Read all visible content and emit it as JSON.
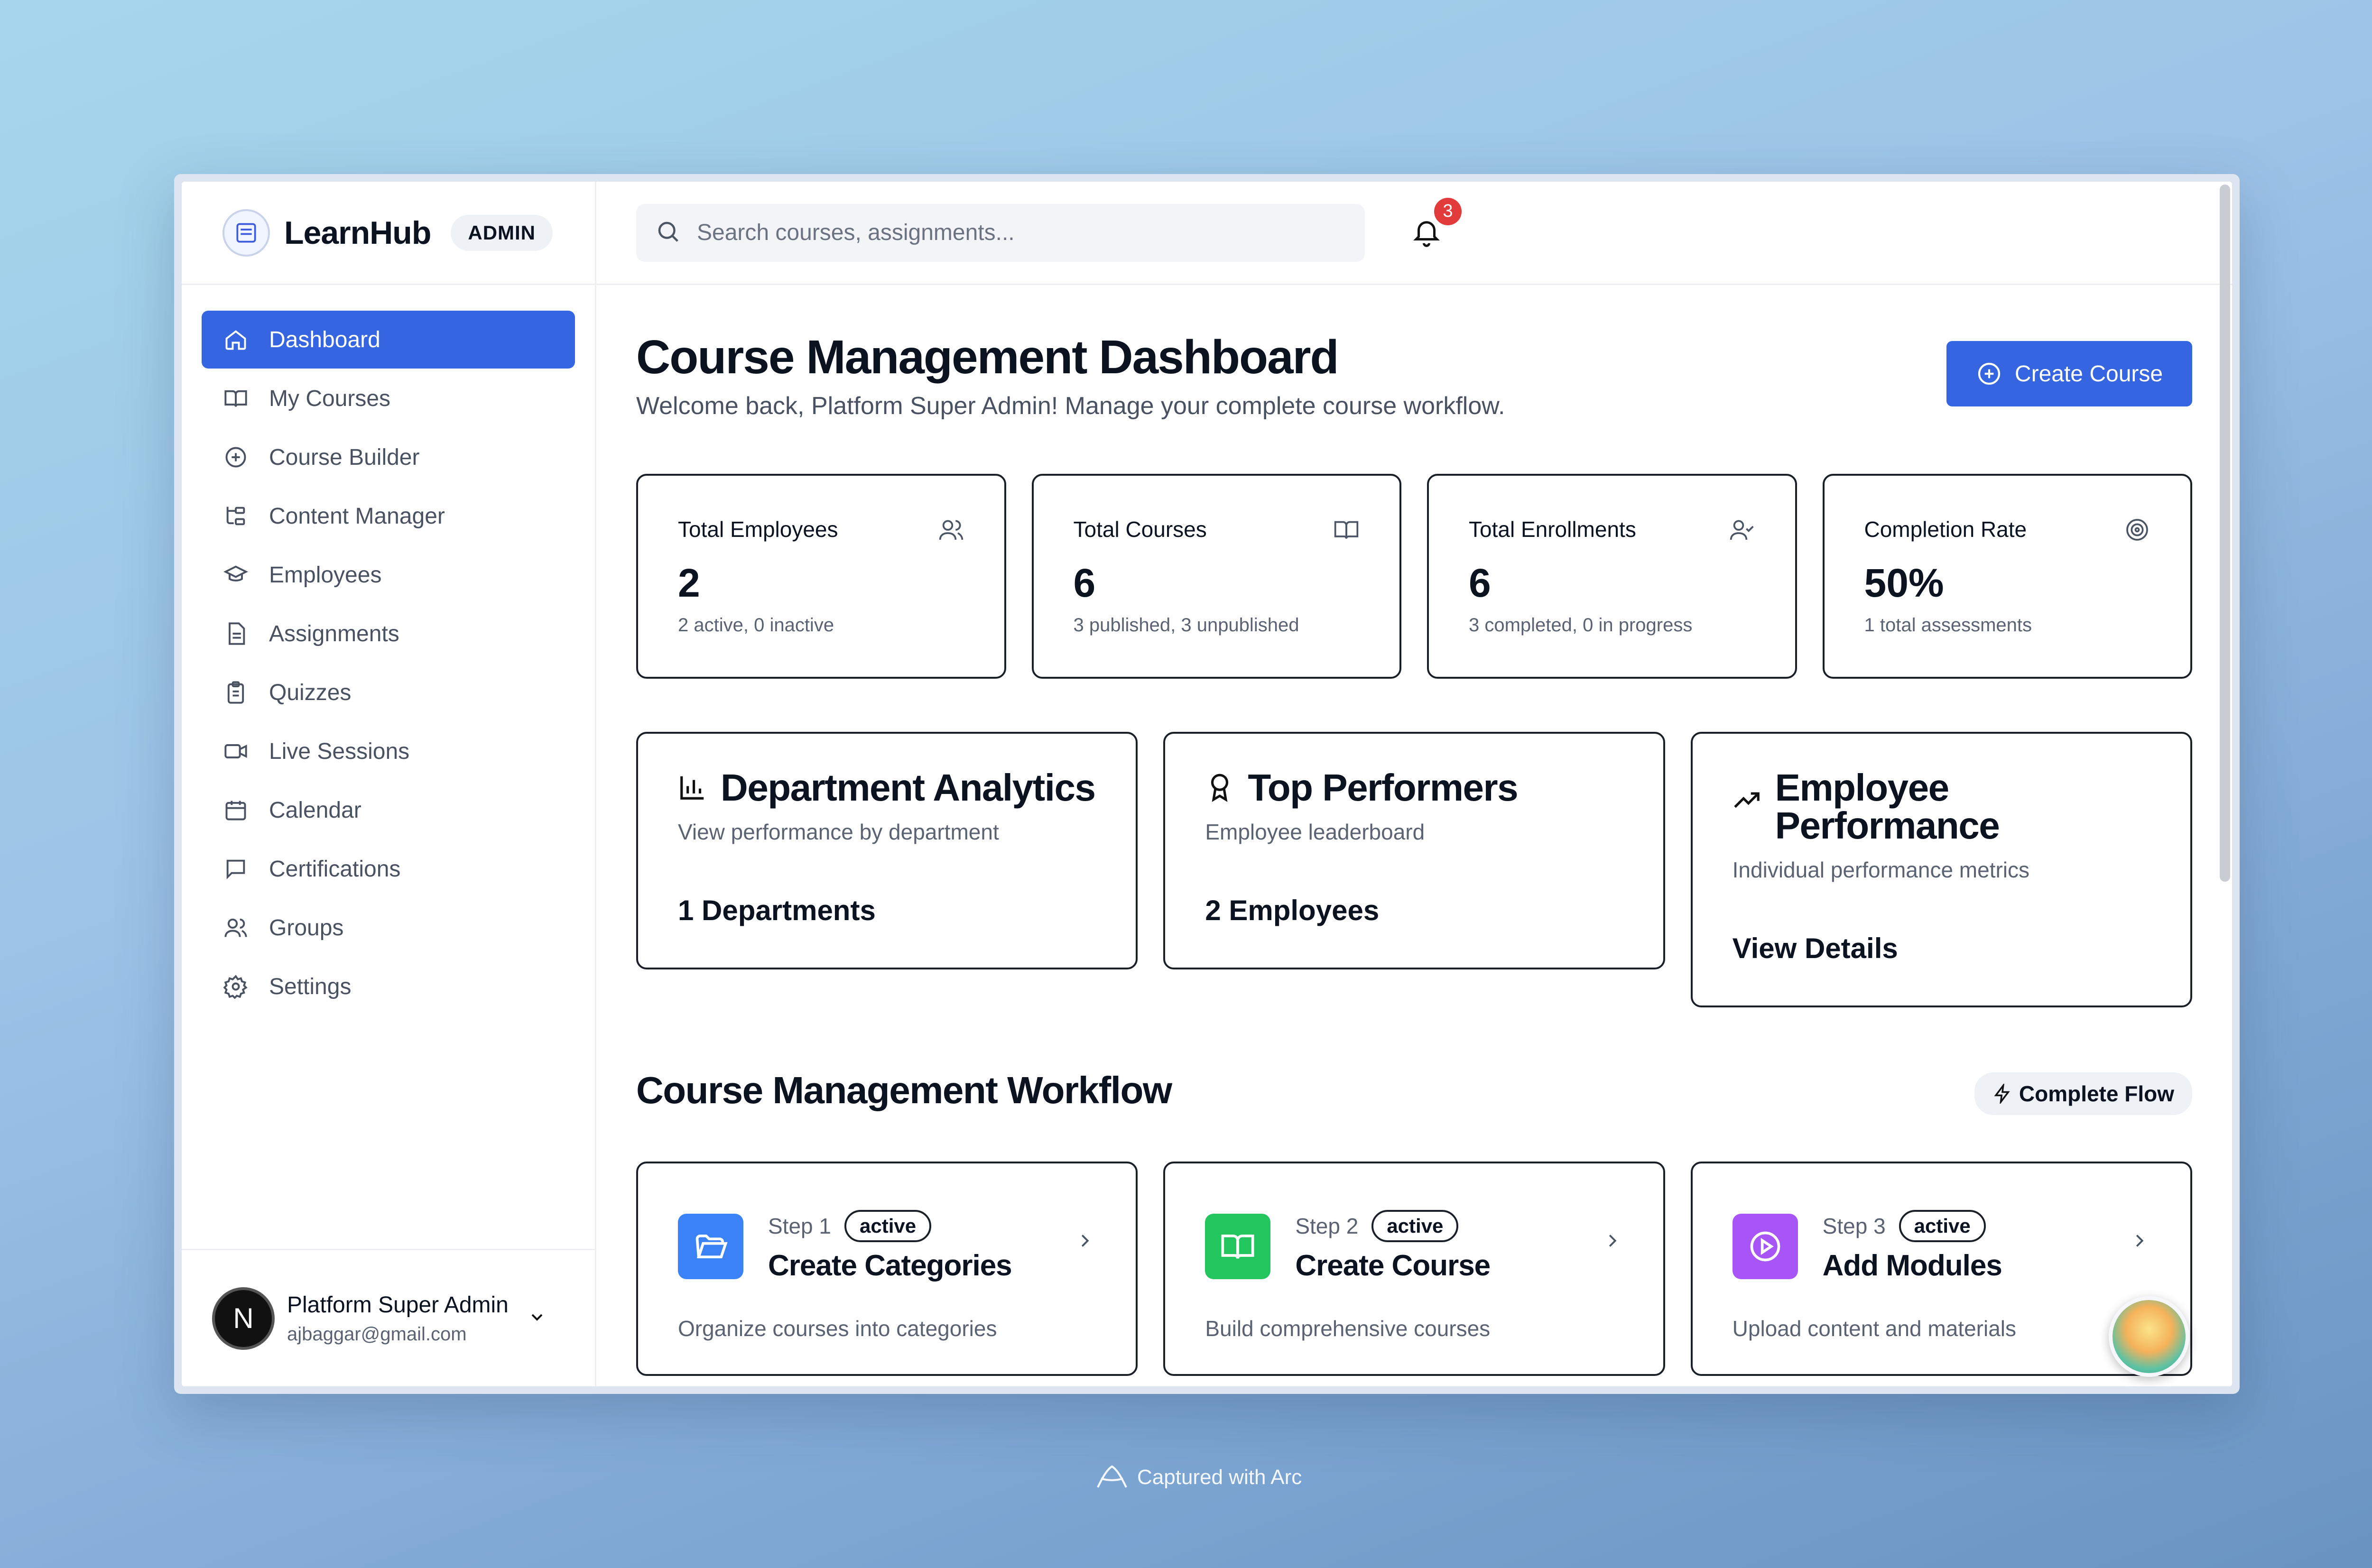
{
  "brand": {
    "name": "LearnHub",
    "badge": "ADMIN"
  },
  "nav": [
    {
      "label": "Dashboard",
      "icon": "home-icon",
      "active": true
    },
    {
      "label": "My Courses",
      "icon": "book-open-icon"
    },
    {
      "label": "Course Builder",
      "icon": "plus-circle-icon"
    },
    {
      "label": "Content Manager",
      "icon": "folder-tree-icon"
    },
    {
      "label": "Employees",
      "icon": "graduation-cap-icon"
    },
    {
      "label": "Assignments",
      "icon": "file-text-icon"
    },
    {
      "label": "Quizzes",
      "icon": "clipboard-list-icon"
    },
    {
      "label": "Live Sessions",
      "icon": "video-icon"
    },
    {
      "label": "Calendar",
      "icon": "calendar-icon"
    },
    {
      "label": "Certifications",
      "icon": "message-square-icon"
    },
    {
      "label": "Groups",
      "icon": "users-icon"
    },
    {
      "label": "Settings",
      "icon": "gear-icon"
    }
  ],
  "user": {
    "initial": "N",
    "name": "Platform Super Admin",
    "email": "ajbaggar@gmail.com"
  },
  "search": {
    "placeholder": "Search courses, assignments..."
  },
  "notifications": {
    "count": "3"
  },
  "page": {
    "title": "Course Management Dashboard",
    "subtitle": "Welcome back, Platform Super Admin! Manage your complete course workflow.",
    "create_label": "Create Course"
  },
  "stats": [
    {
      "label": "Total Employees",
      "value": "2",
      "sub": "2 active, 0 inactive",
      "icon": "users-icon"
    },
    {
      "label": "Total Courses",
      "value": "6",
      "sub": "3 published, 3 unpublished",
      "icon": "book-open-icon"
    },
    {
      "label": "Total Enrollments",
      "value": "6",
      "sub": "3 completed, 0 in progress",
      "icon": "user-check-icon"
    },
    {
      "label": "Completion Rate",
      "value": "50%",
      "sub": "1 total assessments",
      "icon": "target-icon"
    }
  ],
  "cards": [
    {
      "title": "Department Analytics",
      "desc": "View performance by department",
      "value": "1 Departments",
      "icon": "bar-chart-icon"
    },
    {
      "title": "Top Performers",
      "desc": "Employee leaderboard",
      "value": "2 Employees",
      "icon": "award-icon"
    },
    {
      "title": "Employee Performance",
      "desc": "Individual performance metrics",
      "value": "View Details",
      "icon": "trending-up-icon"
    }
  ],
  "workflow": {
    "title": "Course Management Workflow",
    "badge": "Complete Flow",
    "steps": [
      {
        "step": "Step 1",
        "status": "active",
        "name": "Create Categories",
        "desc": "Organize courses into categories",
        "color": "#3b82f6",
        "icon": "folder-open-icon"
      },
      {
        "step": "Step 2",
        "status": "active",
        "name": "Create Course",
        "desc": "Build comprehensive courses",
        "color": "#22c55e",
        "icon": "book-open-icon"
      },
      {
        "step": "Step 3",
        "status": "active",
        "name": "Add Modules",
        "desc": "Upload content and materials",
        "color": "#a855f7",
        "icon": "play-circle-icon"
      }
    ]
  },
  "footer": {
    "capture": "Captured with Arc"
  }
}
